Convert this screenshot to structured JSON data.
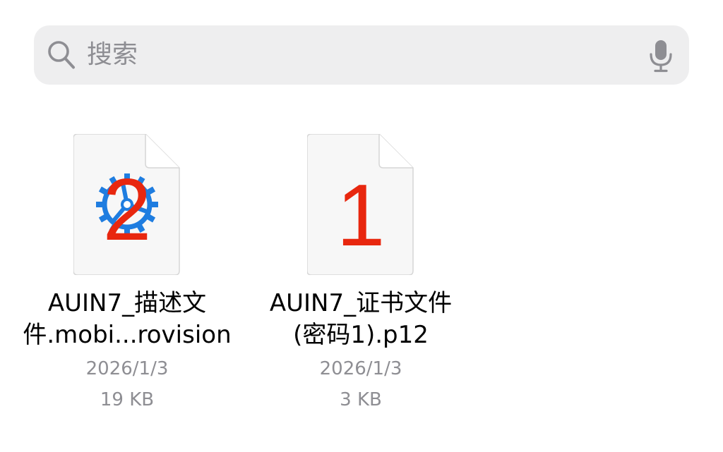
{
  "search": {
    "placeholder": "搜索",
    "icon": "magnifying-glass",
    "mic_icon": "microphone"
  },
  "files": [
    {
      "name_line1": "AUIN7_描述文",
      "name_line2": "件.mobi...rovision",
      "date": "2026/1/3",
      "size": "19 KB",
      "badge": "2",
      "icon": "provisioning-profile-gear"
    },
    {
      "name_line1": "AUIN7_证书文件",
      "name_line2": "(密码1).p12",
      "date": "2026/1/3",
      "size": "3 KB",
      "badge": "1",
      "icon": "certificate-document"
    }
  ],
  "colors": {
    "search_bg": "#eeeeef",
    "placeholder": "#8e8e93",
    "badge_red": "#e8270f",
    "gear_blue": "#1f7de0",
    "doc_fill": "#f7f7f7",
    "doc_stroke": "#d6d6d6",
    "secondary_text": "#8e8e93"
  }
}
